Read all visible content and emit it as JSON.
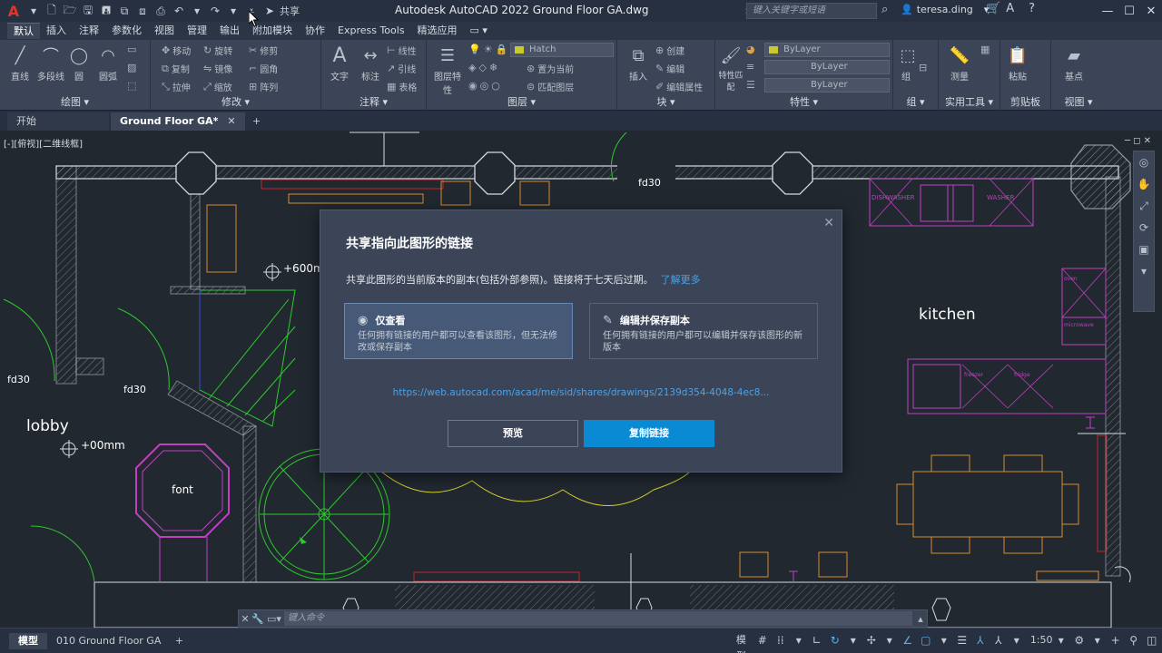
{
  "app": {
    "title": "Autodesk AutoCAD 2022    Ground Floor  GA.dwg",
    "search_placeholder": "键入关键字或短语",
    "user": "teresa.ding",
    "share_label": "共享",
    "brand_color": "#e2322b"
  },
  "ribbon_tabs": [
    "默认",
    "插入",
    "注释",
    "参数化",
    "视图",
    "管理",
    "输出",
    "附加模块",
    "协作",
    "Express Tools",
    "精选应用"
  ],
  "ribbon": {
    "draw": {
      "title": "绘图 ▾",
      "line": "直线",
      "polyline": "多段线",
      "circle": "圆",
      "arc": "圆弧"
    },
    "modify": {
      "title": "修改 ▾",
      "move": "移动",
      "rotate": "旋转",
      "trim": "修剪",
      "copy": "复制",
      "mirror": "镜像",
      "fillet": "圆角",
      "stretch": "拉伸",
      "scale": "缩放",
      "array": "阵列"
    },
    "annotation": {
      "title": "注释 ▾",
      "text": "文字",
      "dimension": "标注",
      "linear": "线性",
      "leader": "引线",
      "table": "表格"
    },
    "layers": {
      "title": "图层 ▾",
      "layer_props": "图层特性",
      "current_layer": "Hatch",
      "make_current": "置为当前",
      "match_layer": "匹配图层"
    },
    "block": {
      "title": "块 ▾",
      "insert": "插入",
      "create": "创建",
      "edit": "编辑",
      "edit_attr": "编辑属性"
    },
    "properties": {
      "title": "特性 ▾",
      "match": "特性匹配",
      "bylayer1": "ByLayer",
      "bylayer2": "ByLayer",
      "bylayer3": "ByLayer"
    },
    "groups": {
      "title": "组 ▾",
      "group": "组"
    },
    "utilities": {
      "title": "实用工具 ▾",
      "measure": "测量"
    },
    "clipboard": {
      "title": "剪贴板",
      "paste": "粘贴"
    },
    "view": {
      "title": "视图 ▾",
      "base": "基点"
    }
  },
  "doc_tabs": {
    "start": "开始",
    "active": "Ground Floor  GA*",
    "close": "✕",
    "add": "+"
  },
  "canvas": {
    "view_label": "[-][俯视][二维线框]",
    "rooms": {
      "lobby": "lobby",
      "kitchen": "kitchen",
      "font": "font"
    },
    "labels": {
      "fd30_a": "fd30",
      "fd30_b": "fd30",
      "fd30_c": "fd30",
      "level_1": "+600mm",
      "level_2": "+00mm"
    },
    "appliances": {
      "dishwasher": "DISHWASHER",
      "washer": "WASHER",
      "oven": "oven",
      "microwave": "microwave",
      "freezer": "freezer",
      "fridge": "fridge"
    }
  },
  "dialog": {
    "title": "共享指向此图形的链接",
    "description": "共享此图形的当前版本的副本(包括外部参照)。链接将于七天后过期。",
    "learn_more": "了解更多",
    "option_view": {
      "title": "仅查看",
      "body": "任何拥有链接的用户都可以查看该图形，但无法修改或保存副本"
    },
    "option_edit": {
      "title": "编辑并保存副本",
      "body": "任何拥有链接的用户都可以编辑并保存该图形的新版本"
    },
    "link": "https://web.autocad.com/acad/me/sid/shares/drawings/2139d354-4048-4ec8...",
    "preview_button": "预览",
    "copy_button": "复制链接",
    "accent": "#0b8ad4"
  },
  "command_line": {
    "placeholder": "键入命令"
  },
  "status": {
    "model_tab": "模型",
    "layout_tab": "010 Ground Floor GA",
    "add": "+",
    "model": "模型",
    "scale": "1:50"
  }
}
